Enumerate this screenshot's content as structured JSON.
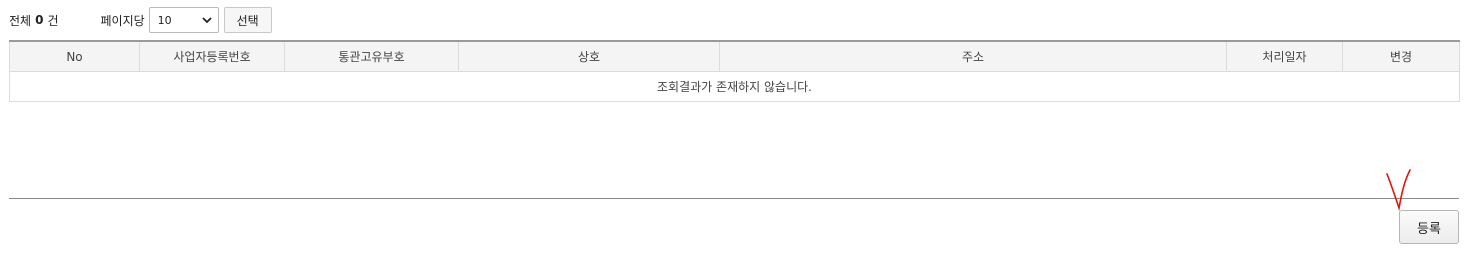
{
  "summary": {
    "total_label": "전체",
    "total_count": "0",
    "total_unit": "건",
    "per_page_label": "페이지당",
    "per_page_value": "10",
    "select_button": "선택"
  },
  "table": {
    "columns": [
      "No",
      "사업자등록번호",
      "통관고유부호",
      "상호",
      "주소",
      "처리일자",
      "변경"
    ],
    "empty_message": "조회결과가 존재하지 않습니다."
  },
  "footer": {
    "register_button": "등록"
  },
  "colors": {
    "annotation_mark": "#e3120b"
  },
  "icons": {
    "select_arrow": "chevron-down-icon",
    "annotation": "check-mark-annotation"
  }
}
